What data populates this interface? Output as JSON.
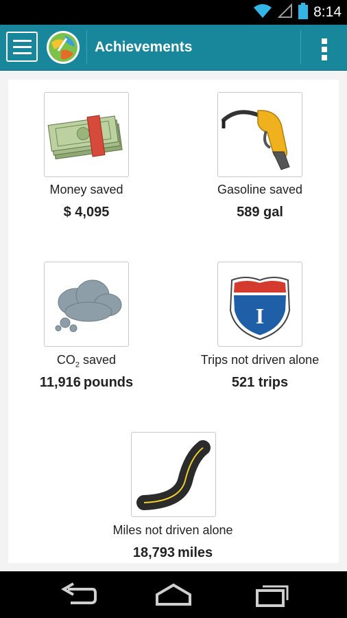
{
  "status_bar": {
    "time": "8:14",
    "icons": [
      "wifi-icon",
      "signal-icon",
      "battery-icon"
    ]
  },
  "action_bar": {
    "title": "Achievements",
    "background": "#18879b",
    "menu_icon": "hamburger-menu-icon",
    "logo_icon": "app-globe-logo",
    "overflow_icon": "overflow-menu-icon"
  },
  "achievements": [
    {
      "icon": "money-stack-icon",
      "label": "Money saved",
      "value": "$ 4,095",
      "unit": ""
    },
    {
      "icon": "gas-pump-nozzle-icon",
      "label": "Gasoline saved",
      "value": "589 gal",
      "unit": ""
    },
    {
      "icon": "cloud-icon",
      "label_prefix": "CO",
      "label_sub": "2",
      "label_suffix": " saved",
      "value": "11,916",
      "unit": "pounds"
    },
    {
      "icon": "interstate-shield-icon",
      "label": "Trips not driven alone",
      "value": "521 trips",
      "unit": "",
      "shield_letter": "I"
    },
    {
      "icon": "winding-road-icon",
      "label": "Miles not driven alone",
      "value": "18,793",
      "unit": "miles"
    }
  ],
  "nav_bar": {
    "icons": [
      "back-icon",
      "home-icon",
      "recent-apps-icon"
    ]
  }
}
